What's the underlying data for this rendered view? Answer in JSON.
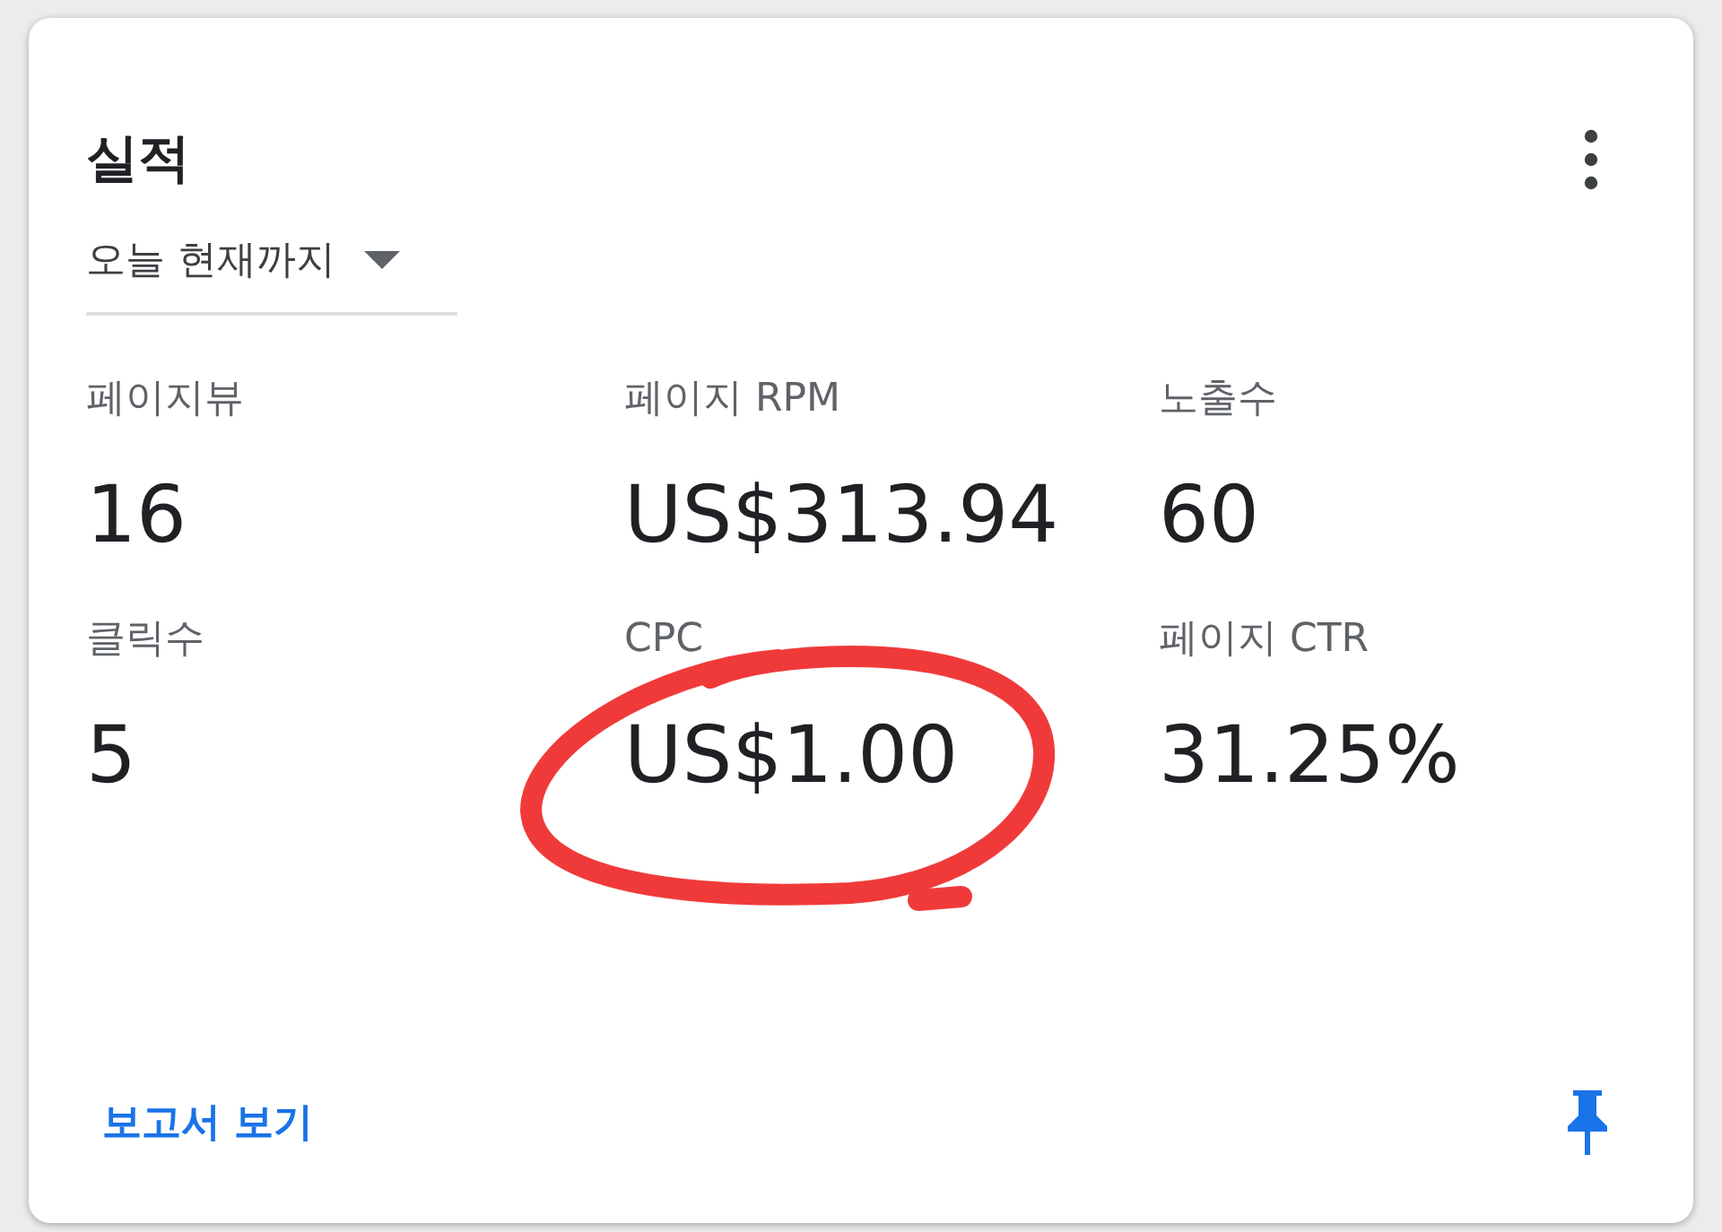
{
  "card": {
    "title": "실적",
    "period": {
      "label": "오늘 현재까지"
    },
    "metrics": [
      {
        "label": "페이지뷰",
        "value": "16",
        "circled": false
      },
      {
        "label": "페이지 RPM",
        "value": "US$313.94",
        "circled": false
      },
      {
        "label": "노출수",
        "value": "60",
        "circled": false
      },
      {
        "label": "클릭수",
        "value": "5",
        "circled": false
      },
      {
        "label": "CPC",
        "value": "US$1.00",
        "circled": true
      },
      {
        "label": "페이지 CTR",
        "value": "31.25%",
        "circled": false
      }
    ],
    "footer": {
      "link": "보고서 보기"
    }
  }
}
